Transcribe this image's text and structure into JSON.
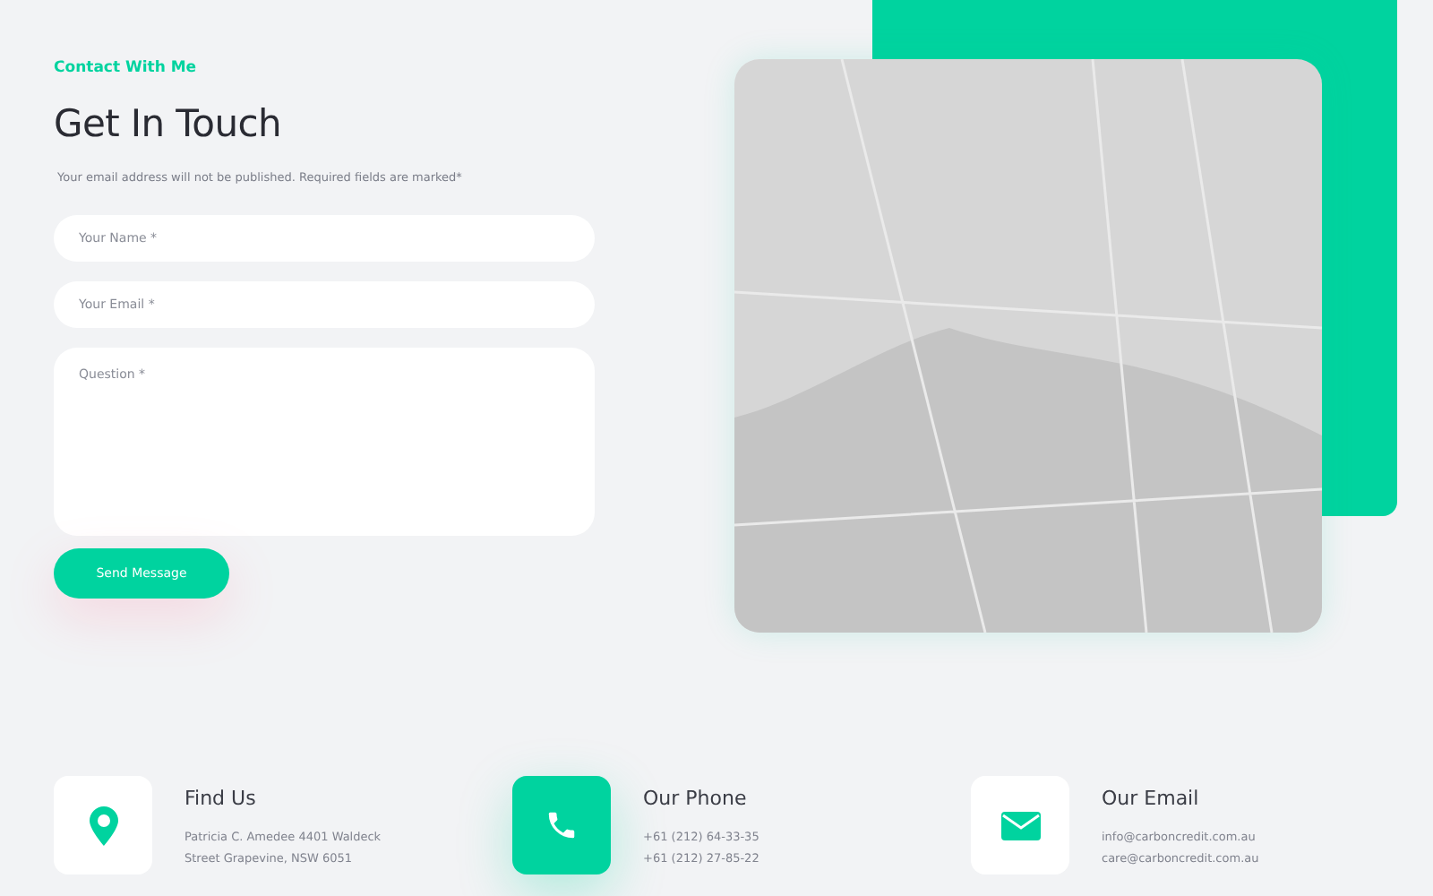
{
  "eyebrow": "Contact With Me",
  "title": "Get In Touch",
  "note": "Your email address will not be published. Required fields are marked*",
  "form": {
    "fields": [
      {
        "kind": "line",
        "placeholder": "Your Name *"
      },
      {
        "kind": "line",
        "placeholder": "Your Email *"
      },
      {
        "kind": "area",
        "placeholder": "Question *"
      }
    ],
    "submit": "Send Message"
  },
  "contacts": [
    {
      "kind": "location",
      "title": "Find Us",
      "highlighted": false,
      "lines": [
        "Patricia C. Amedee 4401 Waldeck",
        "Street Grapevine, NSW 6051"
      ]
    },
    {
      "kind": "phone",
      "title": "Our Phone",
      "highlighted": true,
      "lines": [
        "+61 (212) 64-33-35",
        "+61 (212) 27-85-22"
      ]
    },
    {
      "kind": "email",
      "title": "Our Email",
      "highlighted": false,
      "lines": [
        "info@carboncredit.com.au",
        "care@carboncredit.com.au"
      ]
    }
  ]
}
